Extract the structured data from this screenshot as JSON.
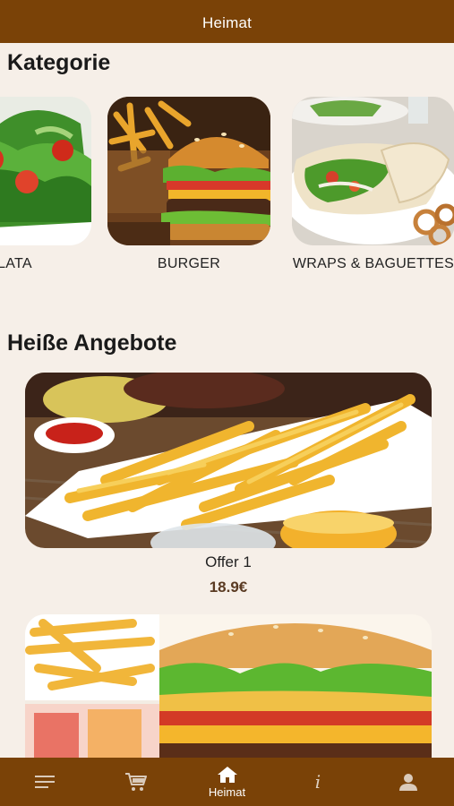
{
  "header": {
    "title": "Heimat"
  },
  "categories_section": {
    "title": "Kategorie",
    "items": [
      {
        "label": "ALATA"
      },
      {
        "label": "BURGER"
      },
      {
        "label": "WRAPS & BAGUETTES"
      }
    ]
  },
  "offers_section": {
    "title": "Heiße Angebote",
    "offers": [
      {
        "name": "Offer 1",
        "price": "18.9€"
      }
    ]
  },
  "bottom_nav": {
    "items": [
      {
        "icon": "menu-icon",
        "label": ""
      },
      {
        "icon": "cart-icon",
        "label": ""
      },
      {
        "icon": "home-icon",
        "label": "Heimat",
        "active": true
      },
      {
        "icon": "info-icon",
        "label": ""
      },
      {
        "icon": "user-icon",
        "label": ""
      }
    ]
  },
  "colors": {
    "brand": "#7a4207",
    "background": "#f6efe8",
    "price": "#5a3a22"
  }
}
